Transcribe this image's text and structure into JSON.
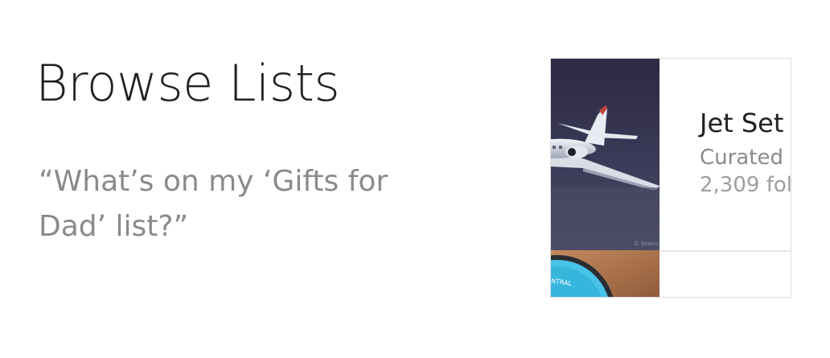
{
  "title": "Browse Lists",
  "query": "“What’s on my ‘Gifts for Dad’ list?”",
  "card": {
    "title": "Jet Set",
    "subtitle": "Curated",
    "followers": "2,309 fol",
    "image_top_caption": "© brainc",
    "image_bottom_caption": "NTRAL"
  }
}
